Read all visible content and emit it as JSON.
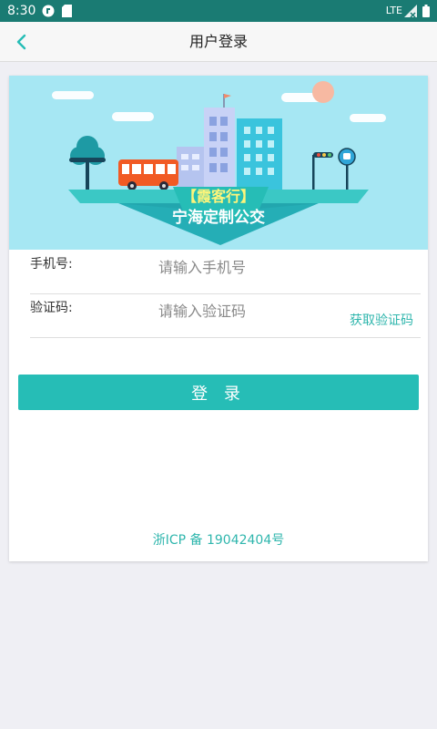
{
  "status_bar": {
    "time": "8:30",
    "network": "LTE",
    "icons": [
      "cast-icon",
      "sd-card-icon",
      "signal-icon",
      "battery-icon"
    ]
  },
  "app_bar": {
    "title": "用户登录",
    "back_icon": "chevron-left-icon"
  },
  "banner": {
    "brand": "【霞客行】",
    "subtitle": "宁海定制公交"
  },
  "form": {
    "phone": {
      "label": "手机号:",
      "placeholder": "请输入手机号",
      "value": ""
    },
    "code": {
      "label": "验证码:",
      "placeholder": "请输入验证码",
      "value": "",
      "action": "获取验证码"
    }
  },
  "login_button": "登 录",
  "footer": {
    "icp": "浙ICP 备 19042404号"
  },
  "colors": {
    "status_bar": "#1a7b73",
    "accent": "#26bdb6",
    "link": "#2fb6ad",
    "banner_sky": "#a6e7f3",
    "background": "#efeff4"
  }
}
